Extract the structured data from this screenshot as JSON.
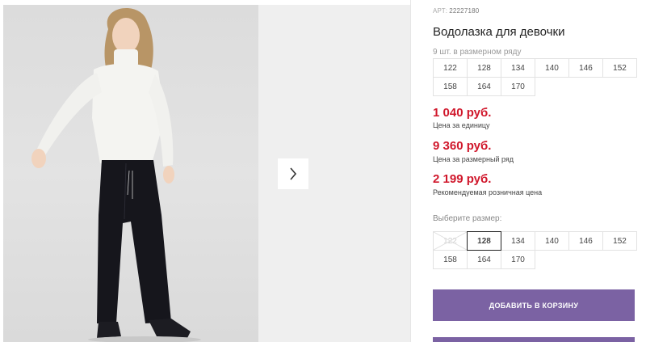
{
  "product": {
    "article_label": "АРТ:",
    "article": "22227180",
    "title": "Водолазка для девочки",
    "pack_note": "9 шт. в размерном ряду"
  },
  "reference_sizes": [
    "122",
    "128",
    "134",
    "140",
    "146",
    "152",
    "158",
    "164",
    "170"
  ],
  "prices": [
    {
      "value": "1 040 руб.",
      "note": "Цена за единицу"
    },
    {
      "value": "9 360 руб.",
      "note": "Цена за размерный ряд"
    },
    {
      "value": "2 199 руб.",
      "note": "Рекомендуемая розничная цена"
    }
  ],
  "size_selector": {
    "label": "Выберите размер:",
    "options": [
      {
        "label": "122",
        "state": "disabled"
      },
      {
        "label": "128",
        "state": "selected"
      },
      {
        "label": "134",
        "state": "available"
      },
      {
        "label": "140",
        "state": "available"
      },
      {
        "label": "146",
        "state": "available"
      },
      {
        "label": "152",
        "state": "available"
      },
      {
        "label": "158",
        "state": "available"
      },
      {
        "label": "164",
        "state": "available"
      },
      {
        "label": "170",
        "state": "available"
      }
    ]
  },
  "cart_button": {
    "label": "ДОБАВИТЬ В КОРЗИНУ"
  },
  "gallery": {
    "next_icon": "chevron-right-icon"
  },
  "colors": {
    "price": "#d0172b",
    "button": "#7b62a3",
    "border": "#e2e2e2"
  }
}
